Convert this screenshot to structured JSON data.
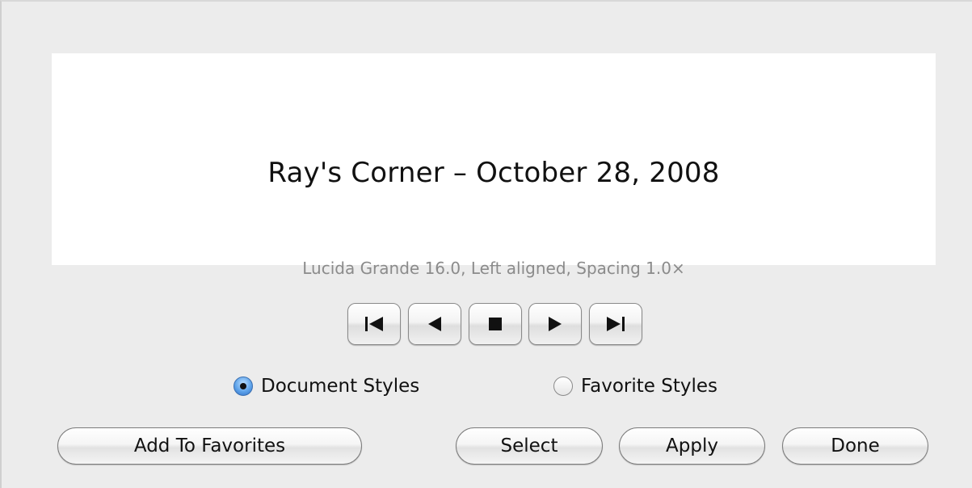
{
  "preview": {
    "title": "Ray's Corner – October 28, 2008",
    "description": "Lucida Grande 16.0, Left aligned, Spacing 1.0×"
  },
  "navigation": {
    "buttons": [
      {
        "name": "first",
        "icon": "skip-to-first-icon"
      },
      {
        "name": "previous",
        "icon": "play-previous-icon"
      },
      {
        "name": "stop",
        "icon": "stop-icon"
      },
      {
        "name": "next",
        "icon": "play-next-icon"
      },
      {
        "name": "last",
        "icon": "skip-to-last-icon"
      }
    ]
  },
  "styles_source": {
    "options": [
      {
        "label": "Document Styles",
        "selected": true
      },
      {
        "label": "Favorite Styles",
        "selected": false
      }
    ]
  },
  "actions": {
    "add_to_favorites": "Add To Favorites",
    "select": "Select",
    "apply": "Apply",
    "done": "Done"
  },
  "colors": {
    "radio_selected": "#5ea3ea",
    "window_background": "#ececec"
  }
}
